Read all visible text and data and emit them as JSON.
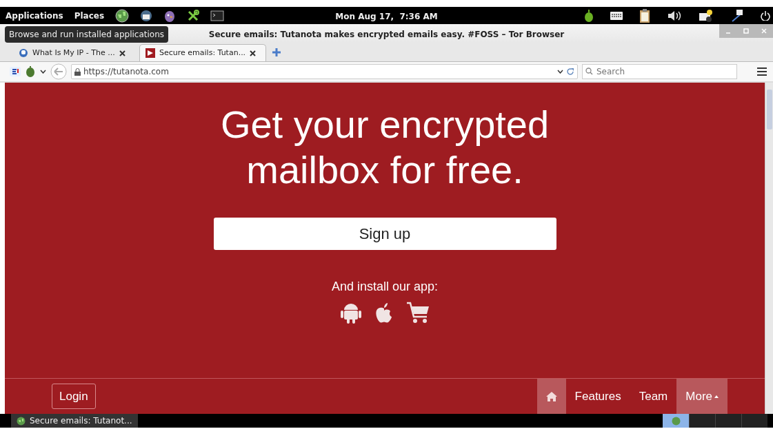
{
  "top_panel": {
    "menus": [
      "Applications",
      "Places"
    ],
    "clock": "Mon Aug 17,  7:36 AM"
  },
  "tooltip": "Browse and run installed applications",
  "window": {
    "title": "Secure emails: Tutanota makes encrypted emails easy. #FOSS – Tor Browser"
  },
  "tabs": [
    {
      "label": "What Is My IP - The ...",
      "selected": false
    },
    {
      "label": "Secure emails: Tutan...",
      "selected": true
    }
  ],
  "address_bar": {
    "url": "https://tutanota.com"
  },
  "search": {
    "placeholder": "Search"
  },
  "hero": {
    "heading": "Get your encrypted mailbox for free.",
    "signup": "Sign up",
    "install_text": "And install our app:"
  },
  "footer_nav": {
    "login": "Login",
    "items": [
      {
        "kind": "home",
        "highlighted": true
      },
      {
        "kind": "link",
        "label": "Features",
        "highlighted": false
      },
      {
        "kind": "link",
        "label": "Team",
        "highlighted": false
      },
      {
        "kind": "dropdown",
        "label": "More",
        "highlighted": true
      }
    ]
  },
  "taskbar": {
    "window_button": "Secure emails: Tutanot..."
  }
}
